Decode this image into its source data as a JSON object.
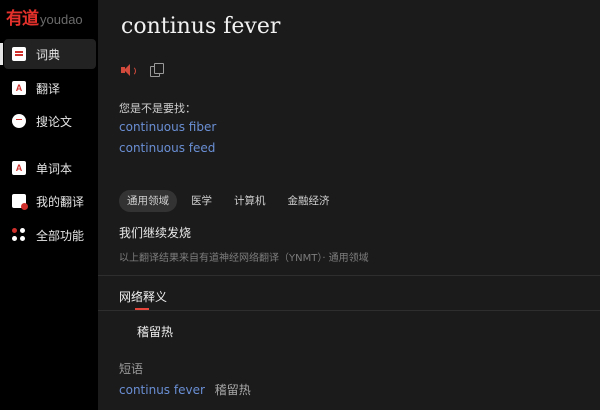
{
  "app": {
    "logo_cn": "有道",
    "logo_en": "youdao"
  },
  "sidebar": {
    "items": [
      {
        "label": "词典",
        "icon": "dictionary-icon",
        "active": true
      },
      {
        "label": "翻译",
        "icon": "translate-icon"
      },
      {
        "label": "搜论文",
        "icon": "paper-search-icon"
      },
      {
        "label": "单词本",
        "icon": "wordbook-icon"
      },
      {
        "label": "我的翻译",
        "icon": "my-translation-icon"
      },
      {
        "label": "全部功能",
        "icon": "all-features-icon"
      }
    ]
  },
  "main": {
    "word": "continus fever",
    "speaker_icon": "speaker-icon",
    "copy_icon": "copy-icon",
    "suggest_label": "您是不是要找：",
    "suggestions": [
      "continuous fiber",
      "continuous feed"
    ],
    "tabs": [
      "通用领域",
      "医学",
      "计算机",
      "金融经济"
    ],
    "active_tab": "通用领域",
    "translation": "我们继续发烧",
    "source_note": "以上翻译结果来自有道神经网络翻译（YNMT）· 通用领域",
    "web_section_title": "网络释义",
    "web_meaning": "稽留热",
    "phrase_label": "短语",
    "phrases": [
      {
        "en": "continus fever",
        "cn": "稽留热"
      }
    ]
  },
  "colors": {
    "accent_red": "#e5312b",
    "link_blue": "#6a8fd4",
    "background": "#1b1b1b",
    "sidebar": "#000000"
  }
}
